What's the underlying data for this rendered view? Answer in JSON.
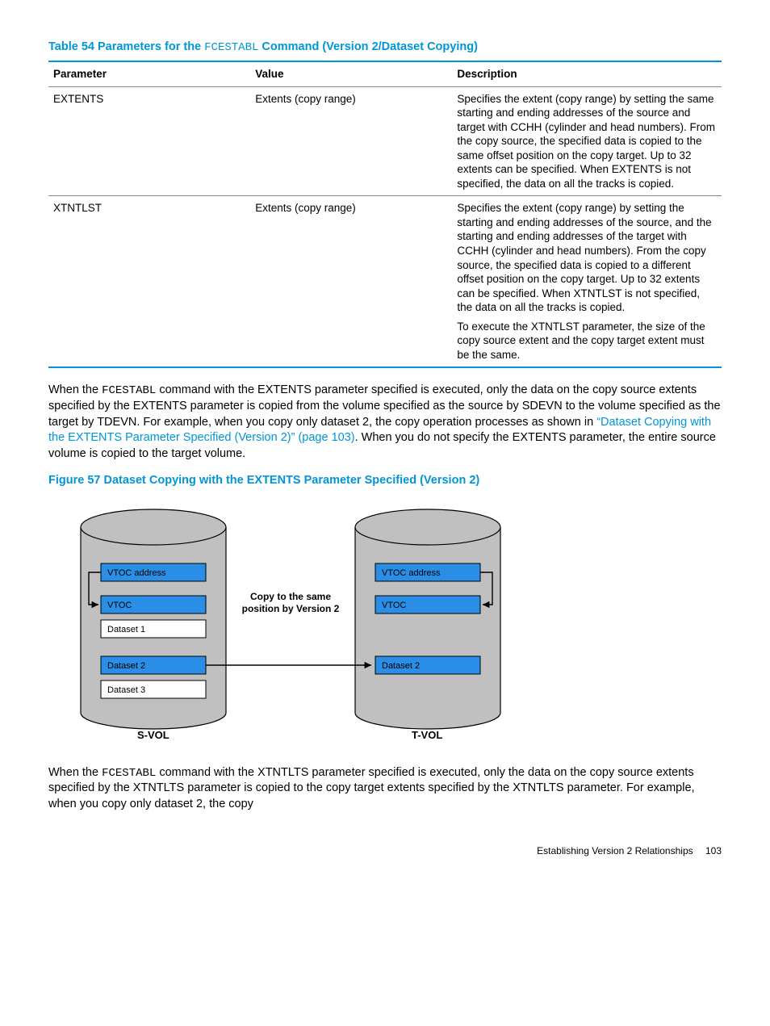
{
  "table": {
    "title_prefix": "Table 54 Parameters for the ",
    "title_code": "FCESTABL",
    "title_suffix": " Command (Version 2/Dataset Copying)",
    "headers": {
      "c1": "Parameter",
      "c2": "Value",
      "c3": "Description"
    },
    "rows": [
      {
        "param": "EXTENTS",
        "value": "Extents (copy range)",
        "desc": [
          "Specifies the extent (copy range) by setting the same starting and ending addresses of the source and target with CCHH (cylinder and head numbers). From the copy source, the specified data is copied to the same offset position on the copy target. Up to 32 extents can be specified. When EXTENTS is not specified, the data on all the tracks is copied."
        ]
      },
      {
        "param": "XTNTLST",
        "value": "Extents (copy range)",
        "desc": [
          "Specifies the extent (copy range) by setting the starting and ending addresses of the source, and the starting and ending addresses of the target with CCHH (cylinder and head numbers). From the copy source, the specified data is copied to a different offset position on the copy target. Up to 32 extents can be specified. When XTNTLST is not specified, the data on all the tracks is copied.",
          "To execute the XTNTLST parameter, the size of the copy source extent and the copy target extent must be the same."
        ]
      }
    ]
  },
  "para1": {
    "part1": "When the ",
    "code": "FCESTABL",
    "part2": " command with the EXTENTS parameter specified is executed, only the data on the copy source extents specified by the EXTENTS parameter is copied from the volume specified as the source by SDEVN to the volume specified as the target by TDEVN. For example, when you copy only dataset 2, the copy operation processes as shown in ",
    "link": "“Dataset Copying with the EXTENTS Parameter Specified (Version 2)” (page 103)",
    "part3": ". When you do not specify the EXTENTS parameter, the entire source volume is copied to the target volume."
  },
  "figure": {
    "title": "Figure 57 Dataset Copying with the EXTENTS Parameter Specified (Version 2)",
    "caption_line1": "Copy to the same",
    "caption_line2": "position by Version 2",
    "svol_label": "S-VOL",
    "tvol_label": "T-VOL",
    "slots_left": {
      "vtoc_addr": "VTOC address",
      "vtoc": "VTOC",
      "d1": "Dataset 1",
      "d2": "Dataset 2",
      "d3": "Dataset 3"
    },
    "slots_right": {
      "vtoc_addr": "VTOC address",
      "vtoc": "VTOC",
      "d2": "Dataset 2"
    }
  },
  "para2": {
    "part1": "When the ",
    "code": "FCESTABL",
    "part2": " command with the XTNTLTS parameter specified is executed, only the data on the copy source extents specified by the XTNTLTS parameter is copied to the copy target extents specified by the XTNTLTS parameter. For example, when you copy only dataset 2, the copy"
  },
  "footer": {
    "section": "Establishing Version 2 Relationships",
    "page": "103"
  }
}
